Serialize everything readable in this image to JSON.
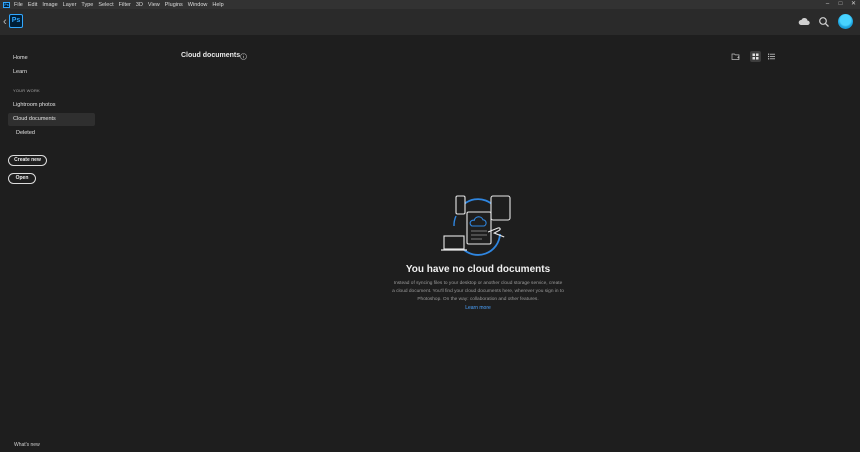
{
  "menu": {
    "ps_mark": "Ps",
    "items": [
      "File",
      "Edit",
      "Image",
      "Layer",
      "Type",
      "Select",
      "Filter",
      "3D",
      "View",
      "Plugins",
      "Window",
      "Help"
    ]
  },
  "window_controls": {
    "minimize": "–",
    "maximize": "□",
    "close": "✕"
  },
  "header": {
    "back_glyph": "‹",
    "logo": "Ps",
    "icons": [
      "cloud-sync-icon",
      "search-icon",
      "avatar"
    ]
  },
  "sidebar": {
    "home": "Home",
    "learn": "Learn",
    "section_label": "YOUR WORK",
    "lightroom": "Lightroom photos",
    "cloud_documents": "Cloud documents",
    "deleted": "Deleted",
    "create_new": "Create new",
    "open": "Open",
    "whats_new": "What's new"
  },
  "main": {
    "title": "Cloud documents",
    "empty_title": "You have no cloud documents",
    "empty_description": "Instead of syncing files to your desktop or another cloud storage service, create a cloud document. You'll find your cloud documents here, wherever you sign in to Photoshop. On the way: collaboration and other features.",
    "learn_more": "Learn more",
    "view_mode": "grid"
  },
  "colors": {
    "accent": "#31a8ff",
    "link": "#4ba3ff",
    "background": "#1e1e1e"
  }
}
